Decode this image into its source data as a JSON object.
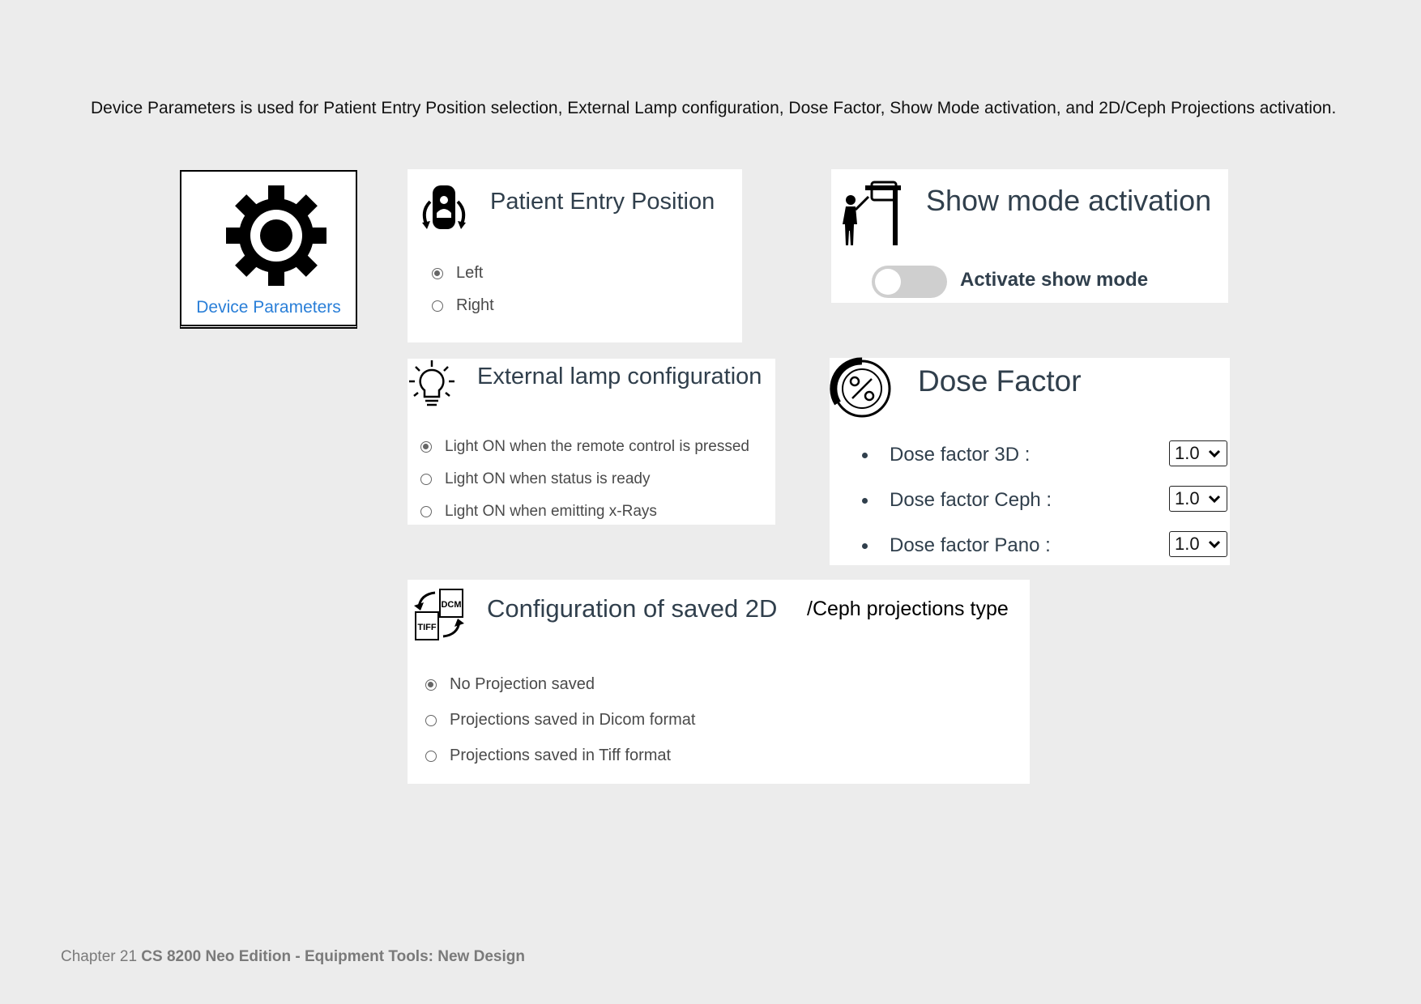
{
  "intro_text": "Device Parameters is used for Patient Entry Position selection, External Lamp configuration, Dose Factor, Show Mode activation, and 2D/Ceph Projections activation.",
  "device_tile": {
    "label": "Device Parameters",
    "icon": "gear-icon"
  },
  "patient_entry": {
    "title": "Patient Entry Position",
    "icon": "patient-entry-icon",
    "options": [
      {
        "label": "Left",
        "selected": true
      },
      {
        "label": "Right",
        "selected": false
      }
    ]
  },
  "show_mode": {
    "title": "Show mode activation",
    "icon": "presenter-icon",
    "toggle_label": "Activate show mode",
    "toggle_on": false
  },
  "external_lamp": {
    "title": "External lamp configuration",
    "icon": "lightbulb-icon",
    "options": [
      {
        "label": "Light ON when the remote control is pressed",
        "selected": true
      },
      {
        "label": "Light ON when status is ready",
        "selected": false
      },
      {
        "label": "Light ON when emitting x-Rays",
        "selected": false
      }
    ]
  },
  "dose_factor": {
    "title": "Dose Factor",
    "icon": "percent-icon",
    "rows": [
      {
        "label": "Dose factor 3D :",
        "value": "1.0"
      },
      {
        "label": "Dose factor Ceph :",
        "value": "1.0"
      },
      {
        "label": "Dose factor Pano :",
        "value": "1.0"
      }
    ]
  },
  "projections": {
    "title": "Configuration of saved 2D",
    "title_suffix": "/Ceph projections type",
    "icon": "dcm-tiff-convert-icon",
    "icon_text_top": "DCM",
    "icon_text_bottom": "TIFF",
    "options": [
      {
        "label": "No Projection saved",
        "selected": true
      },
      {
        "label": "Projections saved in Dicom format",
        "selected": false
      },
      {
        "label": "Projections saved in Tiff format",
        "selected": false
      }
    ]
  },
  "footer": {
    "chapter": "Chapter 21",
    "title": "CS 8200 Neo Edition - Equipment Tools: New Design"
  }
}
